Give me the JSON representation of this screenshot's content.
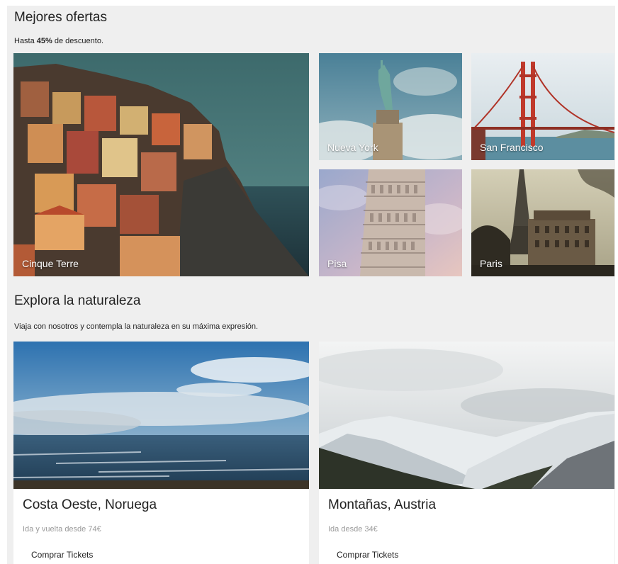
{
  "offers": {
    "title": "Mejores ofertas",
    "subtitle_prefix": "Hasta ",
    "discount": "45%",
    "subtitle_suffix": " de descuento.",
    "tiles": [
      {
        "label": "Cinque Terre"
      },
      {
        "label": "Nueva York"
      },
      {
        "label": "San Francisco"
      },
      {
        "label": "Pisa"
      },
      {
        "label": "Paris"
      }
    ]
  },
  "nature": {
    "title": "Explora la naturaleza",
    "subtitle": "Viaja con nosotros y contempla la naturaleza en su máxima expresión.",
    "cards": [
      {
        "title": "Costa Oeste, Noruega",
        "price": "Ida y vuelta desde 74€",
        "cta": "Comprar Tickets"
      },
      {
        "title": "Montañas, Austria",
        "price": "Ida desde 34€",
        "cta": "Comprar Tickets"
      }
    ]
  }
}
